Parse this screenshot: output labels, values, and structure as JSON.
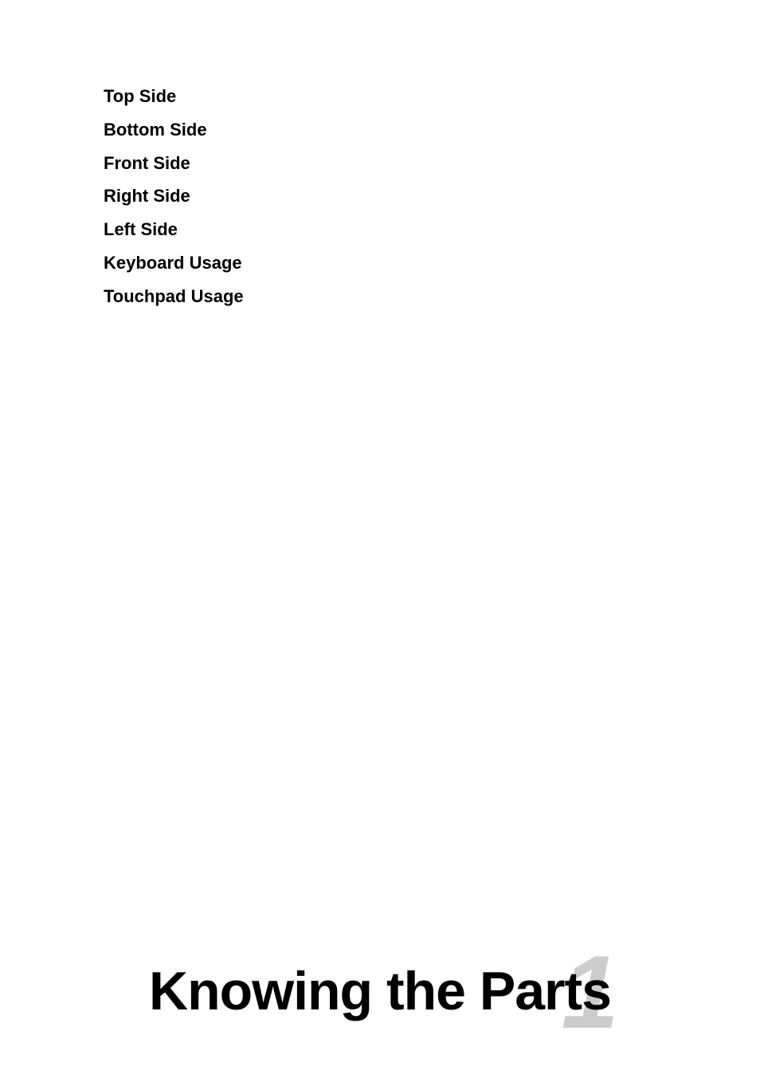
{
  "toc": {
    "items": [
      {
        "id": "top-side",
        "label": "Top Side"
      },
      {
        "id": "bottom-side",
        "label": "Bottom Side"
      },
      {
        "id": "front-side",
        "label": "Front Side"
      },
      {
        "id": "right-side",
        "label": "Right Side"
      },
      {
        "id": "left-side",
        "label": "Left Side"
      },
      {
        "id": "keyboard-usage",
        "label": "Keyboard Usage"
      },
      {
        "id": "touchpad-usage",
        "label": "Touchpad Usage"
      }
    ]
  },
  "chapter": {
    "number": "1",
    "title": "Knowing the Parts"
  }
}
